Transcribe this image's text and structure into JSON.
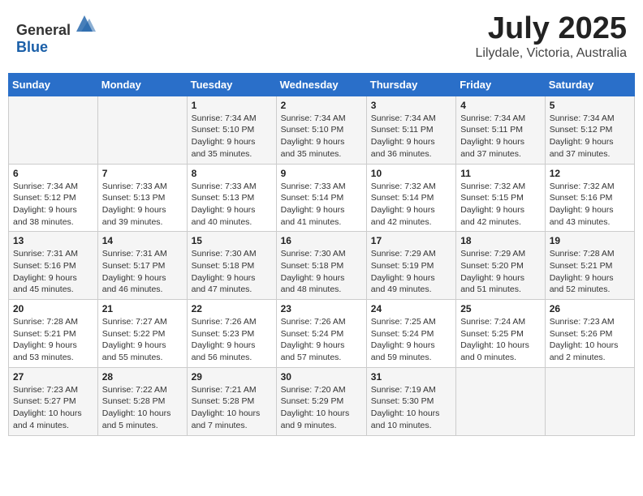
{
  "header": {
    "logo_general": "General",
    "logo_blue": "Blue",
    "month": "July 2025",
    "location": "Lilydale, Victoria, Australia"
  },
  "days_of_week": [
    "Sunday",
    "Monday",
    "Tuesday",
    "Wednesday",
    "Thursday",
    "Friday",
    "Saturday"
  ],
  "weeks": [
    [
      {
        "day": "",
        "detail": ""
      },
      {
        "day": "",
        "detail": ""
      },
      {
        "day": "1",
        "detail": "Sunrise: 7:34 AM\nSunset: 5:10 PM\nDaylight: 9 hours\nand 35 minutes."
      },
      {
        "day": "2",
        "detail": "Sunrise: 7:34 AM\nSunset: 5:10 PM\nDaylight: 9 hours\nand 35 minutes."
      },
      {
        "day": "3",
        "detail": "Sunrise: 7:34 AM\nSunset: 5:11 PM\nDaylight: 9 hours\nand 36 minutes."
      },
      {
        "day": "4",
        "detail": "Sunrise: 7:34 AM\nSunset: 5:11 PM\nDaylight: 9 hours\nand 37 minutes."
      },
      {
        "day": "5",
        "detail": "Sunrise: 7:34 AM\nSunset: 5:12 PM\nDaylight: 9 hours\nand 37 minutes."
      }
    ],
    [
      {
        "day": "6",
        "detail": "Sunrise: 7:34 AM\nSunset: 5:12 PM\nDaylight: 9 hours\nand 38 minutes."
      },
      {
        "day": "7",
        "detail": "Sunrise: 7:33 AM\nSunset: 5:13 PM\nDaylight: 9 hours\nand 39 minutes."
      },
      {
        "day": "8",
        "detail": "Sunrise: 7:33 AM\nSunset: 5:13 PM\nDaylight: 9 hours\nand 40 minutes."
      },
      {
        "day": "9",
        "detail": "Sunrise: 7:33 AM\nSunset: 5:14 PM\nDaylight: 9 hours\nand 41 minutes."
      },
      {
        "day": "10",
        "detail": "Sunrise: 7:32 AM\nSunset: 5:14 PM\nDaylight: 9 hours\nand 42 minutes."
      },
      {
        "day": "11",
        "detail": "Sunrise: 7:32 AM\nSunset: 5:15 PM\nDaylight: 9 hours\nand 42 minutes."
      },
      {
        "day": "12",
        "detail": "Sunrise: 7:32 AM\nSunset: 5:16 PM\nDaylight: 9 hours\nand 43 minutes."
      }
    ],
    [
      {
        "day": "13",
        "detail": "Sunrise: 7:31 AM\nSunset: 5:16 PM\nDaylight: 9 hours\nand 45 minutes."
      },
      {
        "day": "14",
        "detail": "Sunrise: 7:31 AM\nSunset: 5:17 PM\nDaylight: 9 hours\nand 46 minutes."
      },
      {
        "day": "15",
        "detail": "Sunrise: 7:30 AM\nSunset: 5:18 PM\nDaylight: 9 hours\nand 47 minutes."
      },
      {
        "day": "16",
        "detail": "Sunrise: 7:30 AM\nSunset: 5:18 PM\nDaylight: 9 hours\nand 48 minutes."
      },
      {
        "day": "17",
        "detail": "Sunrise: 7:29 AM\nSunset: 5:19 PM\nDaylight: 9 hours\nand 49 minutes."
      },
      {
        "day": "18",
        "detail": "Sunrise: 7:29 AM\nSunset: 5:20 PM\nDaylight: 9 hours\nand 51 minutes."
      },
      {
        "day": "19",
        "detail": "Sunrise: 7:28 AM\nSunset: 5:21 PM\nDaylight: 9 hours\nand 52 minutes."
      }
    ],
    [
      {
        "day": "20",
        "detail": "Sunrise: 7:28 AM\nSunset: 5:21 PM\nDaylight: 9 hours\nand 53 minutes."
      },
      {
        "day": "21",
        "detail": "Sunrise: 7:27 AM\nSunset: 5:22 PM\nDaylight: 9 hours\nand 55 minutes."
      },
      {
        "day": "22",
        "detail": "Sunrise: 7:26 AM\nSunset: 5:23 PM\nDaylight: 9 hours\nand 56 minutes."
      },
      {
        "day": "23",
        "detail": "Sunrise: 7:26 AM\nSunset: 5:24 PM\nDaylight: 9 hours\nand 57 minutes."
      },
      {
        "day": "24",
        "detail": "Sunrise: 7:25 AM\nSunset: 5:24 PM\nDaylight: 9 hours\nand 59 minutes."
      },
      {
        "day": "25",
        "detail": "Sunrise: 7:24 AM\nSunset: 5:25 PM\nDaylight: 10 hours\nand 0 minutes."
      },
      {
        "day": "26",
        "detail": "Sunrise: 7:23 AM\nSunset: 5:26 PM\nDaylight: 10 hours\nand 2 minutes."
      }
    ],
    [
      {
        "day": "27",
        "detail": "Sunrise: 7:23 AM\nSunset: 5:27 PM\nDaylight: 10 hours\nand 4 minutes."
      },
      {
        "day": "28",
        "detail": "Sunrise: 7:22 AM\nSunset: 5:28 PM\nDaylight: 10 hours\nand 5 minutes."
      },
      {
        "day": "29",
        "detail": "Sunrise: 7:21 AM\nSunset: 5:28 PM\nDaylight: 10 hours\nand 7 minutes."
      },
      {
        "day": "30",
        "detail": "Sunrise: 7:20 AM\nSunset: 5:29 PM\nDaylight: 10 hours\nand 9 minutes."
      },
      {
        "day": "31",
        "detail": "Sunrise: 7:19 AM\nSunset: 5:30 PM\nDaylight: 10 hours\nand 10 minutes."
      },
      {
        "day": "",
        "detail": ""
      },
      {
        "day": "",
        "detail": ""
      }
    ]
  ]
}
